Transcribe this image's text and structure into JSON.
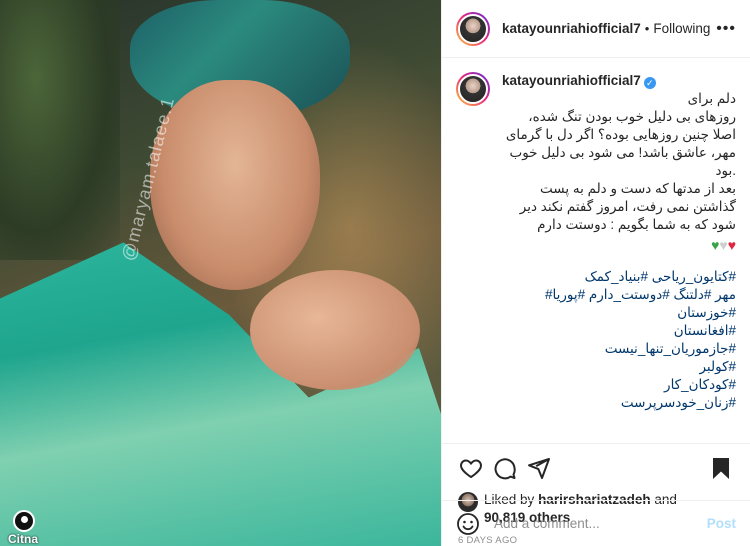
{
  "header": {
    "username": "katayounriahiofficial7",
    "separator": "•",
    "follow_label": "Following",
    "more_label": "•••"
  },
  "photo": {
    "watermark": "@maryam.talaee.1",
    "site_logo": "Citna"
  },
  "caption": {
    "username": "katayounriahiofficial7",
    "verified_mark": "✓",
    "text": "دلم برای\nروزهای بی دلیل خوب بودن تنگ شده،\nاصلا چنین روزهایی بوده؟ اگر دل با گرمای\nمهر، عاشق باشد! می شود بی دلیل خوب\n.بود\nبعد از مدتها که دست و دلم به پست\nگذاشتن نمی رفت، امروز گفتم نکند دیر\nشود که به شما بگویم : دوستت دارم",
    "hearts": [
      "♥",
      "♥",
      "♥"
    ],
    "hashtags": [
      "#کتایون_ریاحی #بنیاد_کمک",
      "مهر #دلتنگ #دوستت_دارم #پوریا#",
      "#خوزستان",
      "#افغانستان",
      "#جازموریان_تنها_نیست",
      "#کولبر",
      "#کودکان_کار",
      "#زنان_خودسرپرست"
    ]
  },
  "likes": {
    "prefix": "Liked by",
    "user": "harirshariatzadeh",
    "and": "and",
    "count": "90,819 others"
  },
  "time": "6 DAYS AGO",
  "comment": {
    "placeholder": "Add a comment...",
    "post_label": "Post"
  },
  "colors": {
    "link": "#00376b",
    "post_disabled": "#b2dffc",
    "verified": "#3897f0",
    "muted": "#8e8e8e"
  },
  "icons": [
    "heart-icon",
    "comment-icon",
    "share-icon",
    "bookmark-icon",
    "emoji-icon",
    "more-icon"
  ]
}
